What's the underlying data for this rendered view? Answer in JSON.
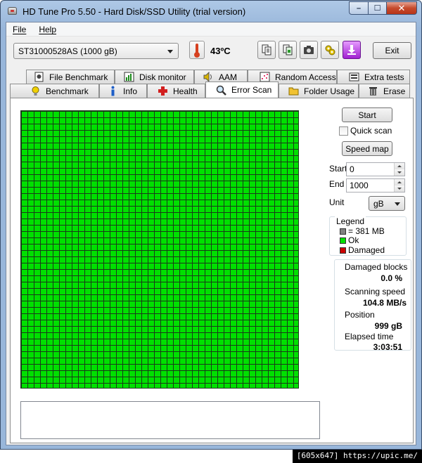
{
  "window": {
    "title": "HD Tune Pro 5.50 - Hard Disk/SSD Utility (trial version)",
    "caption_minimize": "–",
    "caption_maximize": "☐",
    "caption_close": "✕"
  },
  "menu": {
    "items": [
      {
        "label": "File"
      },
      {
        "label": "Help"
      }
    ]
  },
  "toolbar": {
    "drive": "ST31000528AS (1000 gB)",
    "temperature": "43ºC",
    "buttons": [
      {
        "icon": "copy-text-icon"
      },
      {
        "icon": "copy-image-icon"
      },
      {
        "icon": "camera-icon"
      },
      {
        "icon": "options-icon"
      },
      {
        "icon": "save-icon"
      }
    ],
    "exit_label": "Exit"
  },
  "tabs": {
    "row1": [
      {
        "label": "File Benchmark",
        "icon": "file-benchmark-icon"
      },
      {
        "label": "Disk monitor",
        "icon": "disk-monitor-icon"
      },
      {
        "label": "AAM",
        "icon": "speaker-icon"
      },
      {
        "label": "Random Access",
        "icon": "random-access-icon"
      },
      {
        "label": "Extra tests",
        "icon": "extra-tests-icon"
      }
    ],
    "row2": [
      {
        "label": "Benchmark",
        "icon": "lightbulb-icon"
      },
      {
        "label": "Info",
        "icon": "info-icon"
      },
      {
        "label": "Health",
        "icon": "health-cross-icon"
      },
      {
        "label": "Error Scan",
        "icon": "magnifier-icon",
        "active": true
      },
      {
        "label": "Folder Usage",
        "icon": "folder-icon"
      },
      {
        "label": "Erase",
        "icon": "trash-icon"
      }
    ]
  },
  "error_scan": {
    "start_label": "Start",
    "quick_scan_label": "Quick scan",
    "quick_scan_checked": false,
    "speed_map_label": "Speed map",
    "start_field_label": "Start",
    "start_value": "0",
    "end_field_label": "End",
    "end_value": "1000",
    "unit_label": "Unit",
    "unit_value": "gB",
    "legend": {
      "title": "Legend",
      "block_size": "= 381 MB",
      "ok": "Ok",
      "damaged": "Damaged"
    },
    "stats": {
      "damaged_blocks_label": "Damaged blocks",
      "damaged_blocks_value": "0.0 %",
      "scanning_speed_label": "Scanning speed",
      "scanning_speed_value": "104.8 MB/s",
      "position_label": "Position",
      "position_value": "999 gB",
      "elapsed_label": "Elapsed time",
      "elapsed_value": "3:03:51"
    },
    "colors": {
      "ok": "#00e000",
      "damaged": "#cc0000",
      "block": "#808080"
    }
  },
  "watermark": "[605x647] https://upic.me/"
}
